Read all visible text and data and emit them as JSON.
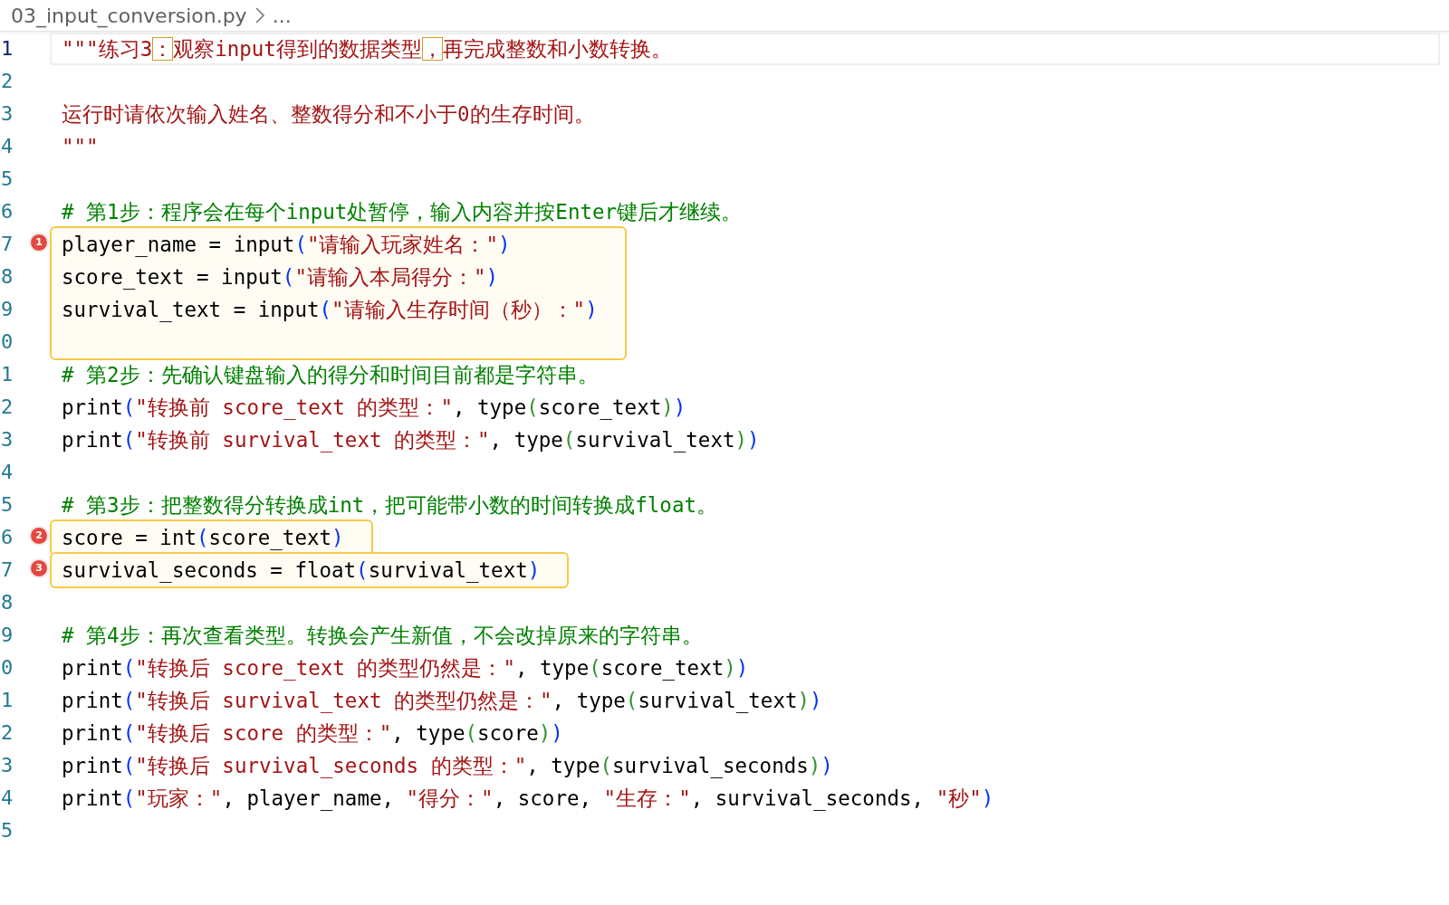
{
  "breadcrumb": {
    "file": "03_input_conversion.py",
    "more": "..."
  },
  "editor": {
    "rows": [
      {
        "kind": "line",
        "number": "1",
        "current": true,
        "tokens": [
          {
            "kind": "string",
            "text": "\"\"\"练习3"
          },
          {
            "kind": "ambiguous",
            "text": "："
          },
          {
            "kind": "string",
            "text": "观察input得到的数据类型"
          },
          {
            "kind": "ambiguous",
            "text": "，"
          },
          {
            "kind": "string",
            "text": "再完成整数和小数转换。"
          }
        ]
      },
      {
        "kind": "line",
        "number": "2",
        "current": false
      },
      {
        "kind": "line",
        "number": "3",
        "current": false,
        "tokens": [
          {
            "kind": "string",
            "text": "运行时请依次输入姓名、整数得分和不小于0的生存时间。"
          }
        ]
      },
      {
        "kind": "line",
        "number": "4",
        "current": false,
        "tokens": [
          {
            "kind": "string",
            "text": "\"\"\""
          }
        ]
      },
      {
        "kind": "line",
        "number": "5",
        "current": false
      },
      {
        "kind": "line",
        "number": "6",
        "current": false,
        "tokens": [
          {
            "kind": "comment",
            "text": "# 第1步：程序会在每个input处暂停，输入内容并按Enter键后才继续。"
          }
        ]
      },
      {
        "kind": "highlight",
        "badge": "1",
        "lines": [
          {
            "number": "7",
            "current": false,
            "tokens": [
              {
                "kind": "plain",
                "text": "player_name = input"
              },
              {
                "kind": "paren1",
                "text": "("
              },
              {
                "kind": "string",
                "text": "\"请输入玩家姓名：\""
              },
              {
                "kind": "paren1",
                "text": ")"
              }
            ]
          },
          {
            "number": "8",
            "current": false,
            "tokens": [
              {
                "kind": "plain",
                "text": "score_text = input"
              },
              {
                "kind": "paren1",
                "text": "("
              },
              {
                "kind": "string",
                "text": "\"请输入本局得分：\""
              },
              {
                "kind": "paren1",
                "text": ")"
              }
            ]
          },
          {
            "number": "9",
            "current": false,
            "tokens": [
              {
                "kind": "plain",
                "text": "survival_text = input"
              },
              {
                "kind": "paren1",
                "text": "("
              },
              {
                "kind": "string",
                "text": "\"请输入生存时间（秒）：\""
              },
              {
                "kind": "paren1",
                "text": ")"
              }
            ]
          },
          {
            "number": "0",
            "current": false
          }
        ]
      },
      {
        "kind": "line",
        "number": "1",
        "current": false,
        "tokens": [
          {
            "kind": "comment",
            "text": "# 第2步：先确认键盘输入的得分和时间目前都是字符串。"
          }
        ]
      },
      {
        "kind": "line",
        "number": "2",
        "current": false,
        "tokens": [
          {
            "kind": "plain",
            "text": "print"
          },
          {
            "kind": "paren1",
            "text": "("
          },
          {
            "kind": "string",
            "text": "\"转换前 score_text 的类型：\""
          },
          {
            "kind": "plain",
            "text": ", type"
          },
          {
            "kind": "paren2",
            "text": "("
          },
          {
            "kind": "plain",
            "text": "score_text"
          },
          {
            "kind": "paren2",
            "text": ")"
          },
          {
            "kind": "paren1",
            "text": ")"
          }
        ]
      },
      {
        "kind": "line",
        "number": "3",
        "current": false,
        "tokens": [
          {
            "kind": "plain",
            "text": "print"
          },
          {
            "kind": "paren1",
            "text": "("
          },
          {
            "kind": "string",
            "text": "\"转换前 survival_text 的类型：\""
          },
          {
            "kind": "plain",
            "text": ", type"
          },
          {
            "kind": "paren2",
            "text": "("
          },
          {
            "kind": "plain",
            "text": "survival_text"
          },
          {
            "kind": "paren2",
            "text": ")"
          },
          {
            "kind": "paren1",
            "text": ")"
          }
        ]
      },
      {
        "kind": "line",
        "number": "4",
        "current": false
      },
      {
        "kind": "line",
        "number": "5",
        "current": false,
        "tokens": [
          {
            "kind": "comment",
            "text": "# 第3步：把整数得分转换成int，把可能带小数的时间转换成float。"
          }
        ]
      },
      {
        "kind": "highlight",
        "badge": "2",
        "lines": [
          {
            "number": "6",
            "current": false,
            "tokens": [
              {
                "kind": "plain",
                "text": "score = int"
              },
              {
                "kind": "paren1",
                "text": "("
              },
              {
                "kind": "plain",
                "text": "score_text"
              },
              {
                "kind": "paren1",
                "text": ")"
              }
            ]
          }
        ]
      },
      {
        "kind": "highlight",
        "badge": "3",
        "lines": [
          {
            "number": "7",
            "current": false,
            "tokens": [
              {
                "kind": "plain",
                "text": "survival_seconds = float"
              },
              {
                "kind": "paren1",
                "text": "("
              },
              {
                "kind": "plain",
                "text": "survival_text"
              },
              {
                "kind": "paren1",
                "text": ")"
              }
            ]
          }
        ]
      },
      {
        "kind": "line",
        "number": "8",
        "current": false
      },
      {
        "kind": "line",
        "number": "9",
        "current": false,
        "tokens": [
          {
            "kind": "comment",
            "text": "# 第4步：再次查看类型。转换会产生新值，不会改掉原来的字符串。"
          }
        ]
      },
      {
        "kind": "line",
        "number": "0",
        "current": false,
        "tokens": [
          {
            "kind": "plain",
            "text": "print"
          },
          {
            "kind": "paren1",
            "text": "("
          },
          {
            "kind": "string",
            "text": "\"转换后 score_text 的类型仍然是：\""
          },
          {
            "kind": "plain",
            "text": ", type"
          },
          {
            "kind": "paren2",
            "text": "("
          },
          {
            "kind": "plain",
            "text": "score_text"
          },
          {
            "kind": "paren2",
            "text": ")"
          },
          {
            "kind": "paren1",
            "text": ")"
          }
        ]
      },
      {
        "kind": "line",
        "number": "1",
        "current": false,
        "tokens": [
          {
            "kind": "plain",
            "text": "print"
          },
          {
            "kind": "paren1",
            "text": "("
          },
          {
            "kind": "string",
            "text": "\"转换后 survival_text 的类型仍然是：\""
          },
          {
            "kind": "plain",
            "text": ", type"
          },
          {
            "kind": "paren2",
            "text": "("
          },
          {
            "kind": "plain",
            "text": "survival_text"
          },
          {
            "kind": "paren2",
            "text": ")"
          },
          {
            "kind": "paren1",
            "text": ")"
          }
        ]
      },
      {
        "kind": "line",
        "number": "2",
        "current": false,
        "tokens": [
          {
            "kind": "plain",
            "text": "print"
          },
          {
            "kind": "paren1",
            "text": "("
          },
          {
            "kind": "string",
            "text": "\"转换后 score 的类型：\""
          },
          {
            "kind": "plain",
            "text": ", type"
          },
          {
            "kind": "paren2",
            "text": "("
          },
          {
            "kind": "plain",
            "text": "score"
          },
          {
            "kind": "paren2",
            "text": ")"
          },
          {
            "kind": "paren1",
            "text": ")"
          }
        ]
      },
      {
        "kind": "line",
        "number": "3",
        "current": false,
        "tokens": [
          {
            "kind": "plain",
            "text": "print"
          },
          {
            "kind": "paren1",
            "text": "("
          },
          {
            "kind": "string",
            "text": "\"转换后 survival_seconds 的类型：\""
          },
          {
            "kind": "plain",
            "text": ", type"
          },
          {
            "kind": "paren2",
            "text": "("
          },
          {
            "kind": "plain",
            "text": "survival_seconds"
          },
          {
            "kind": "paren2",
            "text": ")"
          },
          {
            "kind": "paren1",
            "text": ")"
          }
        ]
      },
      {
        "kind": "line",
        "number": "4",
        "current": false,
        "tokens": [
          {
            "kind": "plain",
            "text": "print"
          },
          {
            "kind": "paren1",
            "text": "("
          },
          {
            "kind": "string",
            "text": "\"玩家：\""
          },
          {
            "kind": "plain",
            "text": ", player_name, "
          },
          {
            "kind": "string",
            "text": "\"得分：\""
          },
          {
            "kind": "plain",
            "text": ", score, "
          },
          {
            "kind": "string",
            "text": "\"生存：\""
          },
          {
            "kind": "plain",
            "text": ", survival_seconds, "
          },
          {
            "kind": "string",
            "text": "\"秒\""
          },
          {
            "kind": "paren1",
            "text": ")"
          }
        ]
      },
      {
        "kind": "line",
        "number": "5",
        "current": false
      }
    ]
  }
}
